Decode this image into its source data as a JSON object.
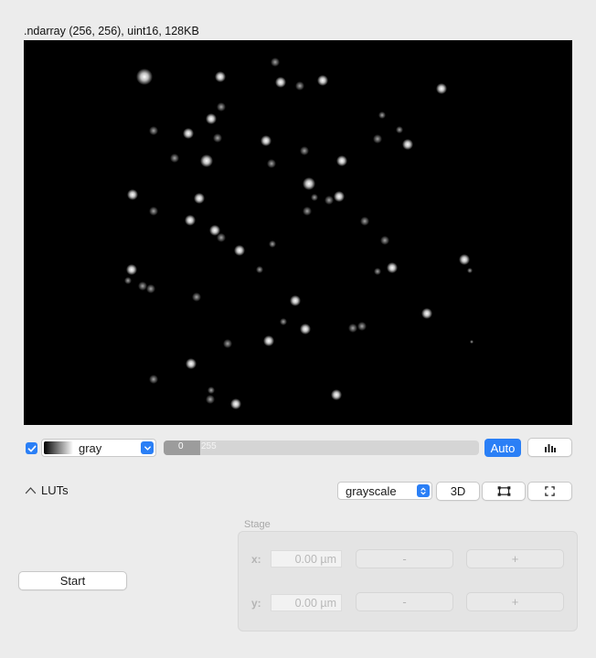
{
  "image": {
    "info": ".ndarray (256, 256), uint16, 128KB",
    "colors": {
      "background": "#000000",
      "spot": "#ffffff"
    }
  },
  "lut": {
    "visible_checked": true,
    "checkbox_icon": "checkmark-icon",
    "colormap_label": "gray",
    "colormap_icon": "chevron-down-icon",
    "clim_min": "0",
    "clim_max": "255",
    "clim_fraction": [
      0.0,
      0.116
    ],
    "auto_label": "Auto",
    "histogram_icon": "histogram-icon",
    "accent": "#2a7ff6"
  },
  "toolbar": {
    "luts_label": "LUTs",
    "luts_icon": "chevron-up-icon",
    "projection_value": "grayscale",
    "projection_icon": "updown-arrows-icon",
    "ndv_3d_label": "3D",
    "roi_icon": "roi-icon",
    "fullscreen_icon": "fullscreen-icon"
  },
  "acquisition": {
    "start_label": "Start"
  },
  "stage": {
    "title": "Stage",
    "x_label": "x:",
    "x_value": "0.00 µm",
    "y_label": "y:",
    "y_value": "0.00 µm",
    "minus_label": "-",
    "plus_label": "+"
  }
}
